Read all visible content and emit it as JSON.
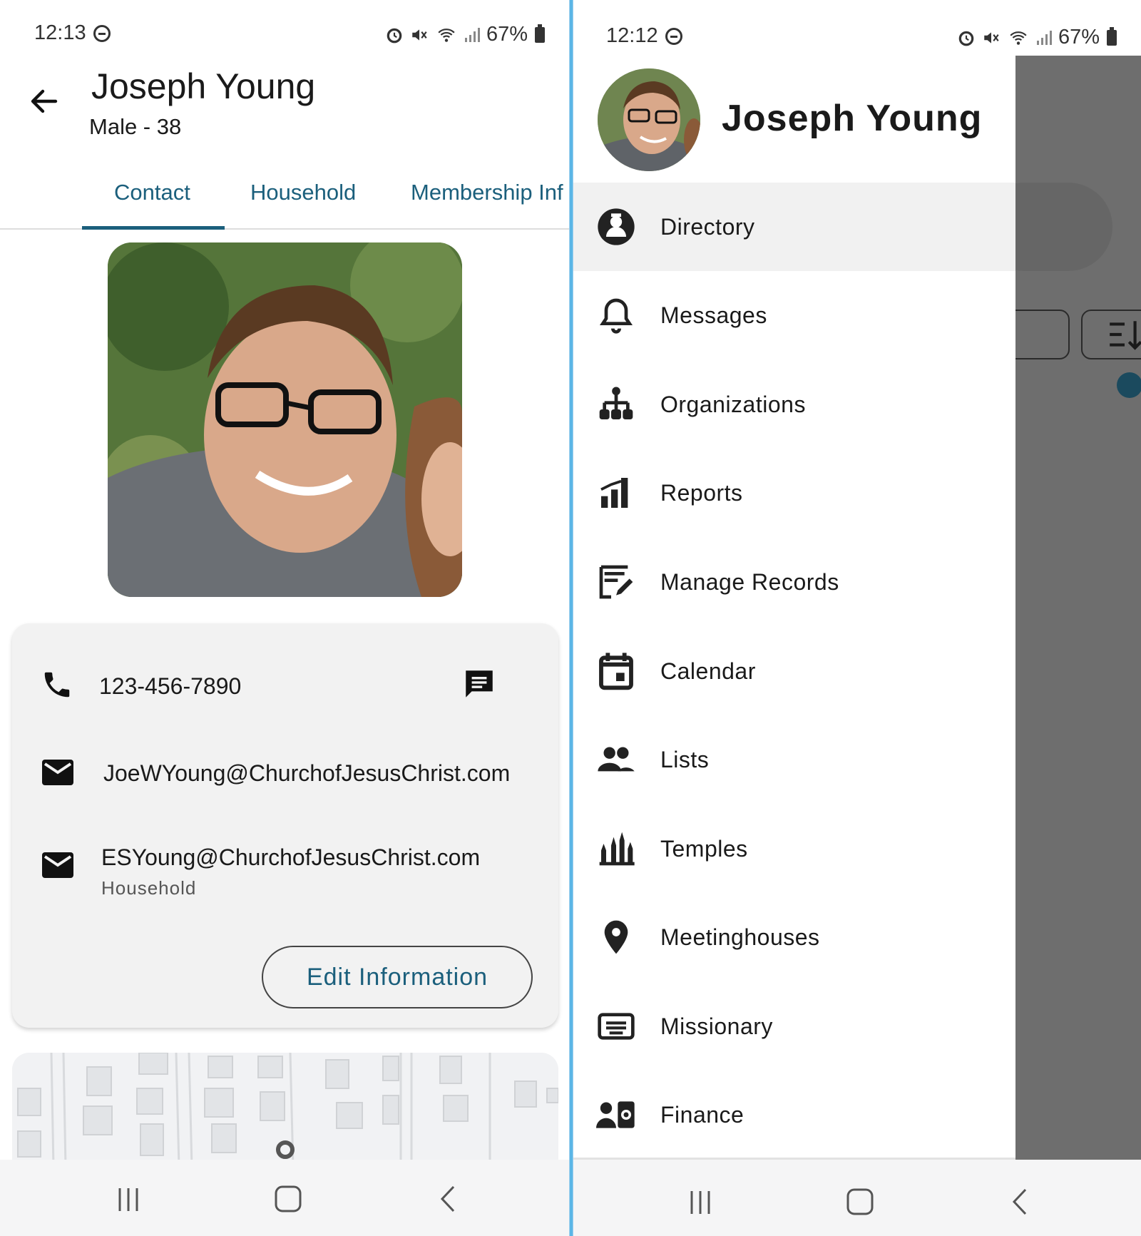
{
  "left": {
    "status": {
      "time": "12:13",
      "battery": "67%"
    },
    "header": {
      "title": "Joseph Young",
      "subtitle": "Male - 38"
    },
    "tabs": [
      {
        "label": "Contact",
        "active": true
      },
      {
        "label": "Household",
        "active": false
      },
      {
        "label": "Membership Inf",
        "active": false
      }
    ],
    "contact": {
      "phone": "123-456-7890",
      "email_personal": "JoeWYoung@ChurchofJesusChrist.com",
      "email_household": "ESYoung@ChurchofJesusChrist.com",
      "email_household_label": "Household",
      "edit_button": "Edit Information"
    }
  },
  "right": {
    "status": {
      "time": "12:12",
      "battery": "67%"
    },
    "drawer": {
      "name": "Joseph Young",
      "items": [
        {
          "label": "Directory",
          "icon": "directory-icon",
          "active": true
        },
        {
          "label": "Messages",
          "icon": "bell-icon"
        },
        {
          "label": "Organizations",
          "icon": "org-chart-icon"
        },
        {
          "label": "Reports",
          "icon": "bar-chart-icon"
        },
        {
          "label": "Manage Records",
          "icon": "edit-records-icon"
        },
        {
          "label": "Calendar",
          "icon": "calendar-icon"
        },
        {
          "label": "Lists",
          "icon": "people-icon"
        },
        {
          "label": "Temples",
          "icon": "temple-icon"
        },
        {
          "label": "Meetinghouses",
          "icon": "location-pin-icon"
        },
        {
          "label": "Missionary",
          "icon": "missionary-badge-icon"
        },
        {
          "label": "Finance",
          "icon": "finance-icon"
        }
      ]
    }
  },
  "colors": {
    "accent": "#1b5f7c",
    "scrim": "#6e6e6e",
    "card": "#f2f2f2"
  }
}
